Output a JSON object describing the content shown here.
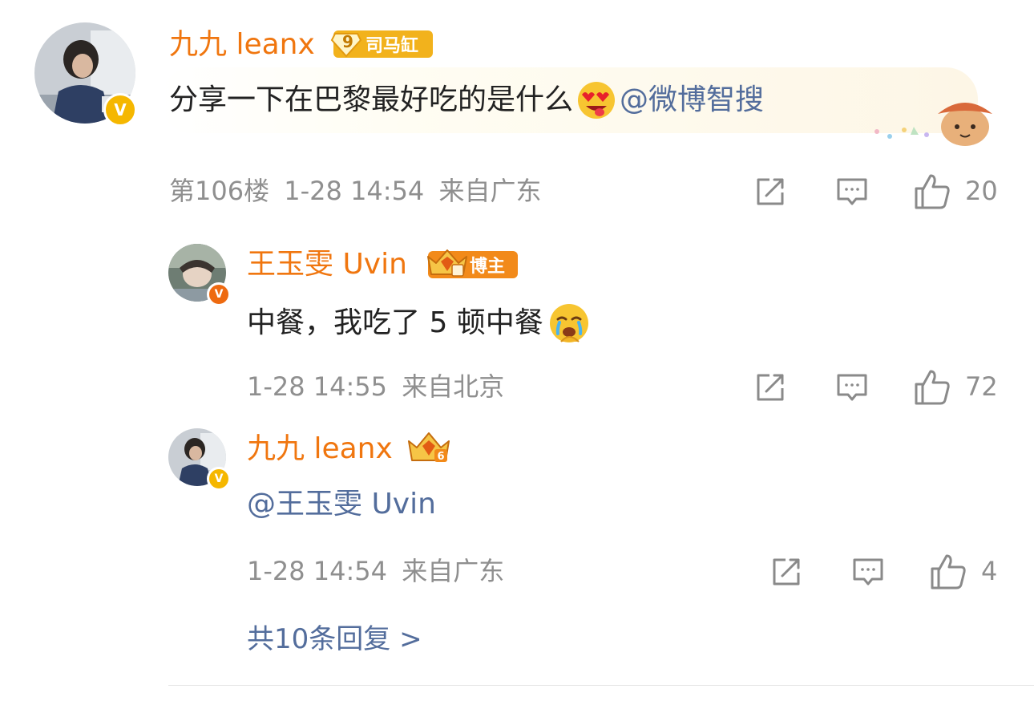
{
  "comment": {
    "username": "九九 leanx",
    "badge_label": "司马缸",
    "badge_level": "9",
    "text": "分享一下在巴黎最好吃的是什么",
    "mention": "@微博智搜",
    "floor": "第106楼",
    "time": "1-28 14:54",
    "location": "来自广东",
    "likes": "20"
  },
  "replies": [
    {
      "username": "王玉雯 Uvin",
      "badge_label": "博主",
      "text": "中餐，我吃了 5 顿中餐",
      "time": "1-28 14:55",
      "location": "来自北京",
      "likes": "72"
    },
    {
      "username": "九九 leanx",
      "badge_level": "6",
      "mention": "@王玉雯 Uvin",
      "time": "1-28 14:54",
      "location": "来自广东",
      "likes": "4"
    }
  ],
  "more_replies": "共10条回复 >",
  "verified_mark": "V",
  "colors": {
    "username": "#f0760f",
    "mention": "#536d9c",
    "meta": "#8f8f8f",
    "verified": "#f5b700",
    "badge_gold": "#f2b21c",
    "badge_orange": "#f28a1a"
  },
  "icons": [
    "share-icon",
    "comment-icon",
    "like-icon",
    "heart-eyes-emoji",
    "crying-emoji",
    "crown-badge-icon"
  ]
}
